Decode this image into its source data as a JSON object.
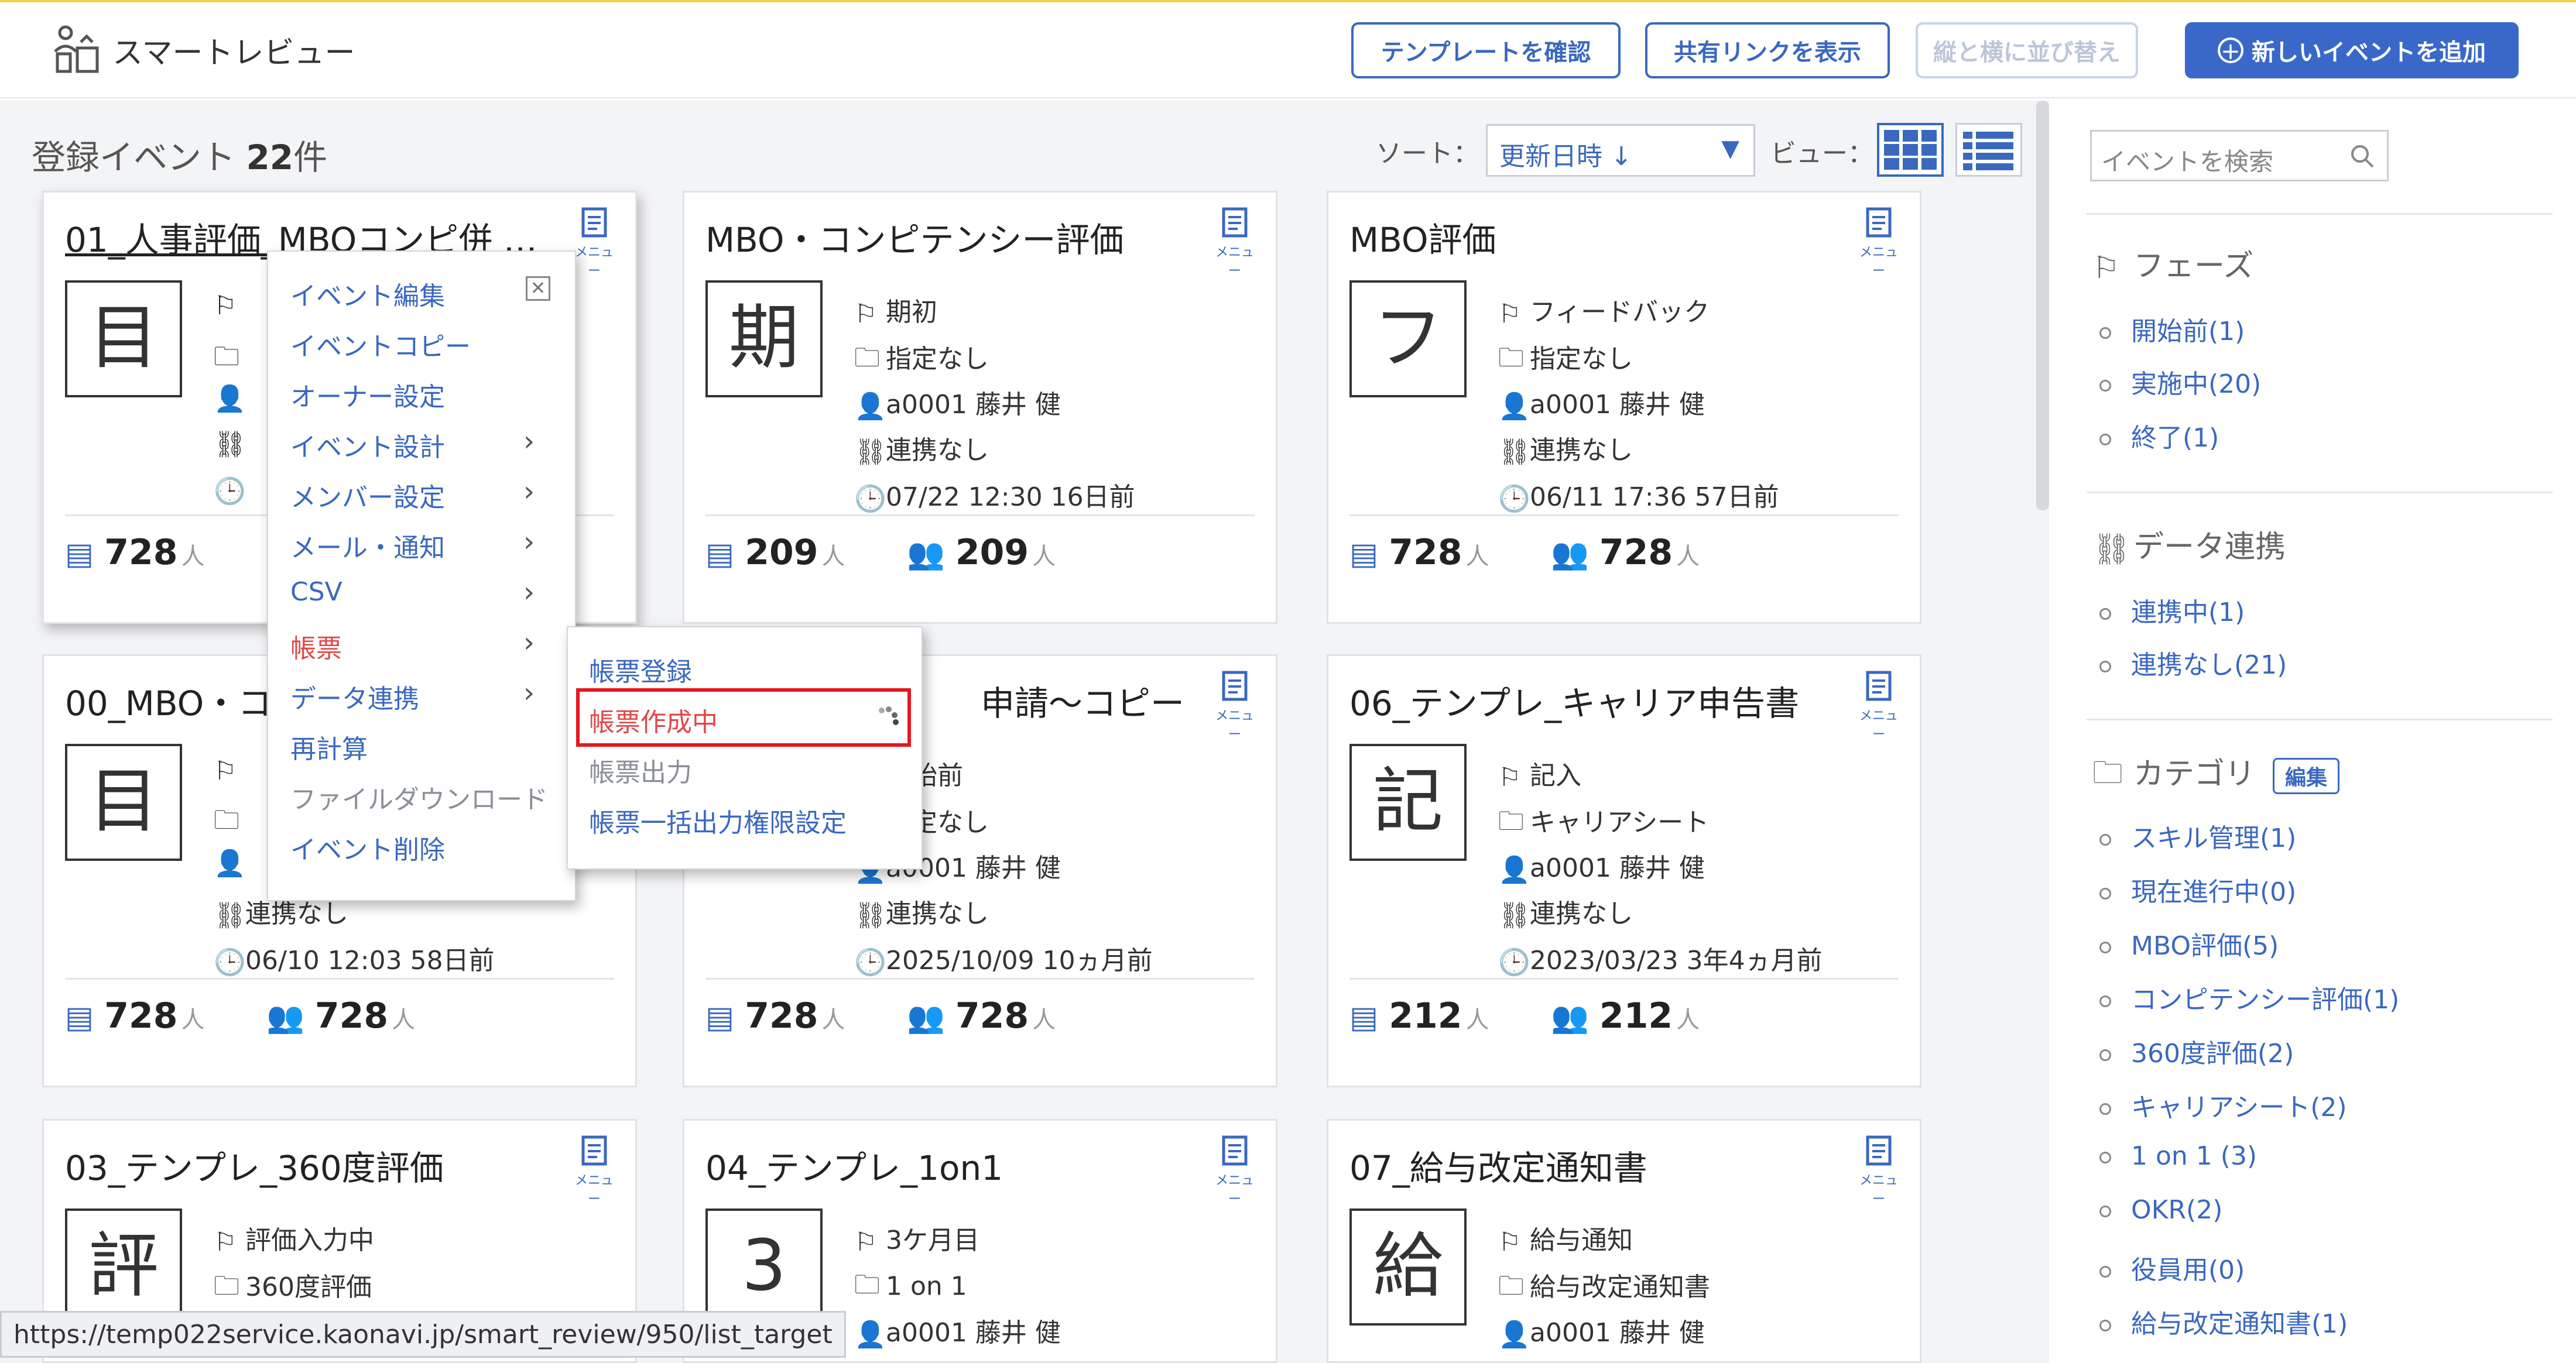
{
  "header": {
    "app_title": "スマートレビュー",
    "btn_template": "テンプレートを確認",
    "btn_share": "共有リンクを表示",
    "btn_sort_grid": "縦と横に並び替え",
    "btn_add": "新しいイベントを追加"
  },
  "toolbar": {
    "count_prefix": "登録イベント ",
    "count_value": "22",
    "count_suffix": "件",
    "sort_label": "ソート：",
    "sort_value": "更新日時 ↓",
    "view_label": "ビュー："
  },
  "menu_label": "メニュー",
  "unit": "人",
  "cards": [
    {
      "title": "01_人事評価_MBOコンピ併 …",
      "kanji": "目",
      "phase": "",
      "category": "",
      "owner": "",
      "link": "",
      "time": "",
      "stat1": "728",
      "stat2": ""
    },
    {
      "title": "MBO・コンピテンシー評価",
      "kanji": "期",
      "phase": "期初",
      "category": "指定なし",
      "owner": "a0001 藤井 健",
      "link": "連携なし",
      "time": "07/22 12:30 16日前",
      "stat1": "209",
      "stat2": "209"
    },
    {
      "title": "MBO評価",
      "kanji": "フ",
      "phase": "フィードバック",
      "category": "指定なし",
      "owner": "a0001 藤井 健",
      "link": "連携なし",
      "time": "06/11 17:36 57日前",
      "stat1": "728",
      "stat2": "728"
    },
    {
      "title": "00_MBO・コ",
      "kanji": "目",
      "phase": "",
      "category": "",
      "owner": "",
      "link": "連携なし",
      "time": "06/10 12:03 58日前",
      "stat1": "728",
      "stat2": "728"
    },
    {
      "title": "申請～コピー",
      "kanji": "",
      "phase": "開始前",
      "category": "指定なし",
      "owner": "a0001 藤井 健",
      "link": "連携なし",
      "time": "2025/10/09 10ヵ月前",
      "stat1": "728",
      "stat2": "728"
    },
    {
      "title": "06_テンプレ_キャリア申告書",
      "kanji": "記",
      "phase": "記入",
      "category": "キャリアシート",
      "owner": "a0001 藤井 健",
      "link": "連携なし",
      "time": "2023/03/23 3年4ヵ月前",
      "stat1": "212",
      "stat2": "212"
    },
    {
      "title": "03_テンプレ_360度評価",
      "kanji": "評",
      "phase": "評価入力中",
      "category": "360度評価",
      "owner": "",
      "link": "",
      "time": "",
      "stat1": "",
      "stat2": ""
    },
    {
      "title": "04_テンプレ_1on1",
      "kanji": "3",
      "phase": "3ケ月目",
      "category": "1 on 1",
      "owner": "a0001 藤井 健",
      "link": "",
      "time": "",
      "stat1": "",
      "stat2": ""
    },
    {
      "title": "07_給与改定通知書",
      "kanji": "給",
      "phase": "給与通知",
      "category": "給与改定通知書",
      "owner": "a0001 藤井 健",
      "link": "",
      "time": "",
      "stat1": "",
      "stat2": ""
    }
  ],
  "context_menu": {
    "items": [
      "イベント編集",
      "イベントコピー",
      "オーナー設定",
      "イベント設計",
      "メンバー設定",
      "メール・通知",
      "CSV",
      "帳票",
      "データ連携",
      "再計算",
      "ファイルダウンロード",
      "イベント削除"
    ]
  },
  "submenu": {
    "items": [
      "帳票登録",
      "帳票作成中",
      "帳票出力",
      "帳票一括出力権限設定"
    ]
  },
  "sidebar": {
    "search_placeholder": "イベントを検索",
    "phase_title": "フェーズ",
    "phase_items": [
      "開始前(1)",
      "実施中(20)",
      "終了(1)"
    ],
    "link_title": "データ連携",
    "link_items": [
      "連携中(1)",
      "連携なし(21)"
    ],
    "category_title": "カテゴリ",
    "category_edit": "編集",
    "category_items": [
      "スキル管理(1)",
      "現在進行中(0)",
      "MBO評価(5)",
      "コンピテンシー評価(1)",
      "360度評価(2)",
      "キャリアシート(2)",
      "1 on 1 (3)",
      "OKR(2)",
      "役員用(0)",
      "給与改定通知書(1)"
    ]
  },
  "statusbar": {
    "url": "https://temp022service.kaonavi.jp/smart_review/950/list_target"
  },
  "colors": {
    "accent": "#3a68bf",
    "primary_button": "#3a68c8",
    "highlight": "#e8161e",
    "background": "#f3f4f6"
  }
}
